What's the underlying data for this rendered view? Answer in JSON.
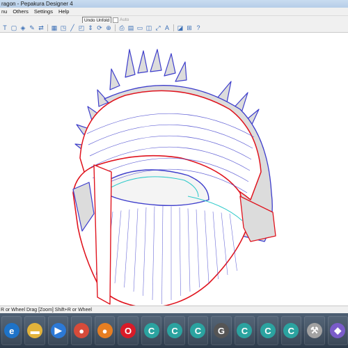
{
  "window": {
    "title": "ragon - Pepakura Designer 4"
  },
  "menu": {
    "items": [
      "nu",
      "Others",
      "Settings",
      "Help"
    ]
  },
  "toolbar": {
    "unfold_label": "Undo Unfold",
    "auto_label": "Auto"
  },
  "tools": [
    {
      "name": "open-icon",
      "glyph": "T"
    },
    {
      "name": "save-icon",
      "glyph": "▢"
    },
    {
      "name": "cube-icon",
      "glyph": "◈"
    },
    {
      "name": "paint-icon",
      "glyph": "✎"
    },
    {
      "name": "flip-icon",
      "glyph": "⇄"
    },
    {
      "name": "grid-icon",
      "glyph": "▦"
    },
    {
      "name": "face-icon",
      "glyph": "◳"
    },
    {
      "name": "edge-icon",
      "glyph": "╱"
    },
    {
      "name": "select-icon",
      "glyph": "◰"
    },
    {
      "name": "move-icon",
      "glyph": "⇕"
    },
    {
      "name": "rotate-icon",
      "glyph": "⟳"
    },
    {
      "name": "join-icon",
      "glyph": "⊕"
    },
    {
      "name": "print-icon",
      "glyph": "⎙"
    },
    {
      "name": "print-preview-icon",
      "glyph": "▤"
    },
    {
      "name": "page-icon",
      "glyph": "▭"
    },
    {
      "name": "flap-icon",
      "glyph": "◫"
    },
    {
      "name": "scale-icon",
      "glyph": "⤢"
    },
    {
      "name": "text-icon",
      "glyph": "A"
    },
    {
      "name": "image-icon",
      "glyph": "◪"
    },
    {
      "name": "arrange-icon",
      "glyph": "⊞"
    },
    {
      "name": "help-icon",
      "glyph": "?"
    }
  ],
  "statusbar": {
    "text": "R or Wheel Drag [Zoom] Shift+R or Wheel"
  },
  "taskbar": {
    "apps": [
      {
        "name": "edge-app-icon",
        "glyph": "e",
        "color": "#1e73c8"
      },
      {
        "name": "explorer-app-icon",
        "glyph": "▬",
        "color": "#e2b33b"
      },
      {
        "name": "media-app-icon",
        "glyph": "▶",
        "color": "#2c79d6"
      },
      {
        "name": "chrome-app-icon",
        "glyph": "●",
        "color": "#d64b3a"
      },
      {
        "name": "firefox-app-icon",
        "glyph": "●",
        "color": "#e67e22"
      },
      {
        "name": "opera-app-icon",
        "glyph": "O",
        "color": "#d91b28"
      },
      {
        "name": "c-app-icon-1",
        "glyph": "C",
        "color": "#2ba3a0"
      },
      {
        "name": "c-app-icon-2",
        "glyph": "C",
        "color": "#2ba3a0"
      },
      {
        "name": "c-app-icon-3",
        "glyph": "C",
        "color": "#2ba3a0"
      },
      {
        "name": "g-app-icon",
        "glyph": "G",
        "color": "#555555"
      },
      {
        "name": "c-app-icon-4",
        "glyph": "C",
        "color": "#2ba3a0"
      },
      {
        "name": "c-app-icon-5",
        "glyph": "C",
        "color": "#2ba3a0"
      },
      {
        "name": "c-app-icon-6",
        "glyph": "C",
        "color": "#2ba3a0"
      },
      {
        "name": "tools-app-icon",
        "glyph": "⚒",
        "color": "#a2a2a2"
      },
      {
        "name": "pepakura-app-icon",
        "glyph": "◆",
        "color": "#7a5cc9"
      }
    ]
  },
  "colors": {
    "model_fill": "#ffffff",
    "model_shade": "#dcdcdc",
    "edge_blue": "#3d3dcc",
    "edge_red": "#e0141e",
    "edge_cyan": "#2cc9c9"
  }
}
